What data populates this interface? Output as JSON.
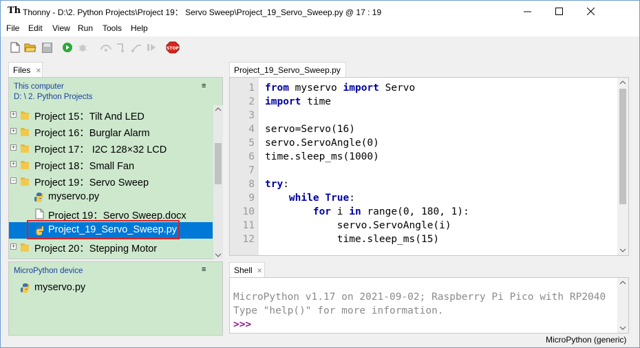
{
  "window": {
    "app_name": "Thonny",
    "title": "Thonny  -  D:\\2. Python Projects\\Project 19： Servo Sweep\\Project_19_Servo_Sweep.py  @  17 : 19",
    "app_icon_glyph": "Th"
  },
  "menu": [
    "File",
    "Edit",
    "View",
    "Run",
    "Tools",
    "Help"
  ],
  "files_panel": {
    "tab_label": "Files",
    "location_label": "This computer",
    "location_path": "D: \\ 2. Python Projects",
    "items": [
      {
        "label": "Project 15：Tilt And LED",
        "type": "folder",
        "expanded": false
      },
      {
        "label": "Project 16：Burglar Alarm",
        "type": "folder",
        "expanded": false
      },
      {
        "label": "Project 17： I2C 128×32 LCD",
        "type": "folder",
        "expanded": false
      },
      {
        "label": "Project 18：Small Fan",
        "type": "folder",
        "expanded": false
      },
      {
        "label": "Project 19：Servo Sweep",
        "type": "folder",
        "expanded": true
      },
      {
        "label": "myservo.py",
        "type": "python"
      },
      {
        "label": "Project 19：Servo Sweep.docx",
        "type": "document"
      },
      {
        "label": "Project_19_Servo_Sweep.py",
        "type": "python",
        "selected": true
      },
      {
        "label": "Project 20：Stepping Motor",
        "type": "folder",
        "expanded": false
      }
    ]
  },
  "device_panel": {
    "label": "MicroPython device",
    "items": [
      {
        "label": "myservo.py",
        "type": "python"
      }
    ]
  },
  "editor": {
    "tab_label": "Project_19_Servo_Sweep.py",
    "line_numbers": [
      "1",
      "2",
      "3",
      "4",
      "5",
      "6",
      "7",
      "8",
      "9",
      "10",
      "11",
      "12"
    ]
  },
  "shell": {
    "tab_label": "Shell",
    "lines": [
      "MicroPython v1.17 on 2021-09-02; Raspberry Pi Pico with RP2040",
      "Type \"help()\" for more information."
    ],
    "prompt": ">>>"
  },
  "status": {
    "interpreter": "MicroPython (generic)"
  },
  "colors": {
    "panel_bg": "#cde8cd",
    "selection": "#0078d7",
    "keyword": "#0000a6",
    "highlight_box": "#e02020"
  }
}
